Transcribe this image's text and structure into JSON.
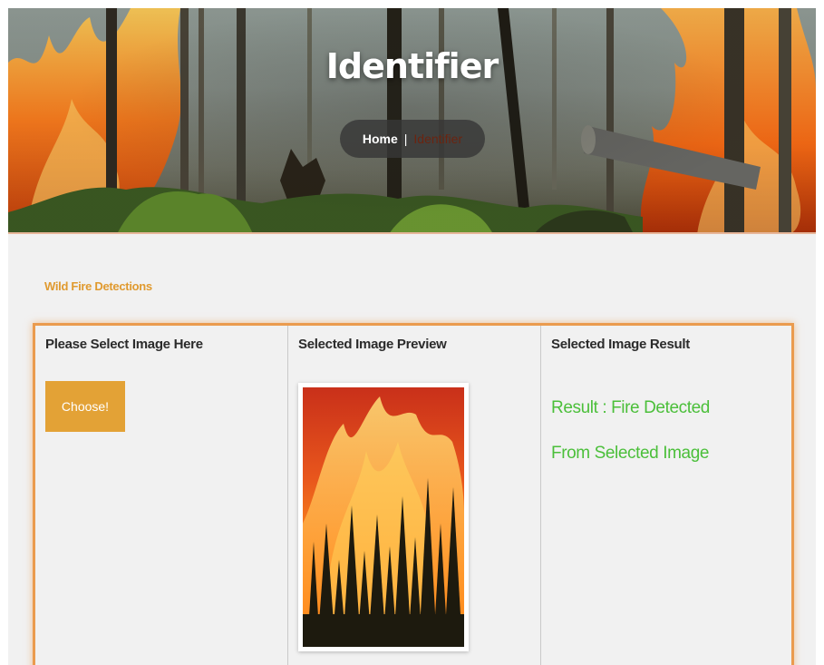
{
  "hero": {
    "title": "Identifier",
    "breadcrumb": {
      "home": "Home",
      "separator": "|",
      "current": "Identifier"
    }
  },
  "content": {
    "section_title": "Wild Fire Detections",
    "columns": [
      {
        "heading": "Please Select Image Here"
      },
      {
        "heading": "Selected Image Preview"
      },
      {
        "heading": "Selected Image Result"
      }
    ],
    "choose_button": "Choose!",
    "result": "Result : Fire Detected From Selected Image"
  },
  "colors": {
    "accent": "#e3a236",
    "section_title": "#e09a2f",
    "panel_border": "#ea9b4e",
    "result": "#4bbf3a",
    "breadcrumb_current": "#6b2410"
  }
}
